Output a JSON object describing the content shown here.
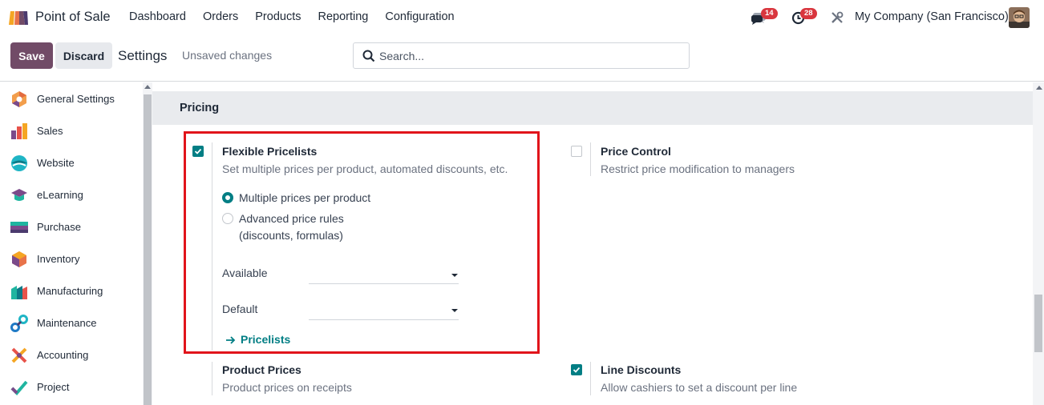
{
  "app": {
    "name": "Point of Sale",
    "logo_icon": "pos-store-logo-icon"
  },
  "nav": [
    "Dashboard",
    "Orders",
    "Products",
    "Reporting",
    "Configuration"
  ],
  "systray": {
    "messages_count": "14",
    "activities_count": "28",
    "company": "My Company (San Francisco)"
  },
  "control": {
    "save_label": "Save",
    "discard_label": "Discard",
    "title": "Settings",
    "status": "Unsaved changes",
    "search_placeholder": "Search..."
  },
  "sidebar": {
    "items": [
      {
        "label": "General Settings",
        "icon": "general-settings-icon"
      },
      {
        "label": "Sales",
        "icon": "sales-icon"
      },
      {
        "label": "Website",
        "icon": "website-icon"
      },
      {
        "label": "eLearning",
        "icon": "elearning-icon"
      },
      {
        "label": "Purchase",
        "icon": "purchase-icon"
      },
      {
        "label": "Inventory",
        "icon": "inventory-icon"
      },
      {
        "label": "Manufacturing",
        "icon": "manufacturing-icon"
      },
      {
        "label": "Maintenance",
        "icon": "maintenance-icon"
      },
      {
        "label": "Accounting",
        "icon": "accounting-icon"
      },
      {
        "label": "Project",
        "icon": "project-icon"
      }
    ]
  },
  "pricing": {
    "section_title": "Pricing",
    "flexible": {
      "title": "Flexible Pricelists",
      "desc": "Set multiple prices per product, automated discounts, etc.",
      "checked": true,
      "options": [
        "Multiple prices per product",
        "Advanced price rules",
        "(discounts, formulas)"
      ],
      "selected_option": "Multiple prices per product",
      "available_label": "Available",
      "default_label": "Default",
      "link": "Pricelists"
    },
    "price_control": {
      "title": "Price Control",
      "desc": "Restrict price modification to managers",
      "checked": false
    },
    "product_prices": {
      "title": "Product Prices",
      "desc": "Product prices on receipts"
    },
    "line_discounts": {
      "title": "Line Discounts",
      "desc": "Allow cashiers to set a discount per line",
      "checked": true
    }
  },
  "colors": {
    "brand": "#714b67",
    "accent": "#017e84",
    "highlight": "#e1141b",
    "badge": "#d9363e"
  }
}
